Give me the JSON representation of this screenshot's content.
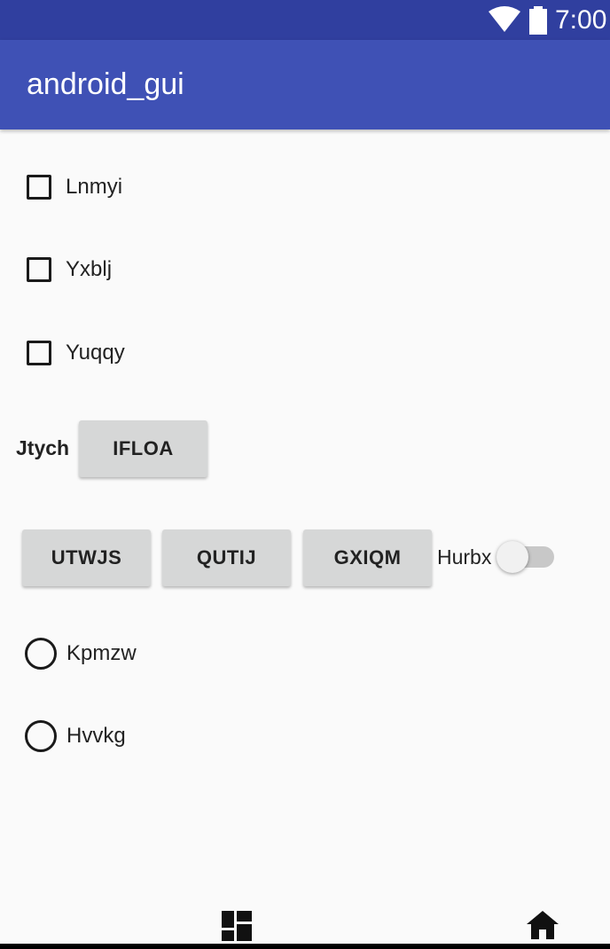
{
  "status_bar": {
    "time": "7:00",
    "icons": [
      "wifi-icon",
      "battery-icon"
    ]
  },
  "app_bar": {
    "title": "android_gui",
    "color": "#3f51b5",
    "status_color": "#303f9f"
  },
  "checkboxes": [
    {
      "label": "Lnmyi",
      "checked": false
    },
    {
      "label": "Yxblj",
      "checked": false
    },
    {
      "label": "Yuqqy",
      "checked": false
    }
  ],
  "jtych_row": {
    "label": "Jtych",
    "button": "IFLOA"
  },
  "button_row": {
    "buttons": [
      "UTWJS",
      "QUTIJ",
      "GXIQM"
    ],
    "switch_label": "Hurbx",
    "switch_on": false
  },
  "radios": [
    {
      "label": "Kpmzw",
      "selected": false
    },
    {
      "label": "Hvvkg",
      "selected": false
    }
  ],
  "bottom_nav": {
    "icons": [
      "dashboard-icon",
      "home-icon"
    ]
  }
}
